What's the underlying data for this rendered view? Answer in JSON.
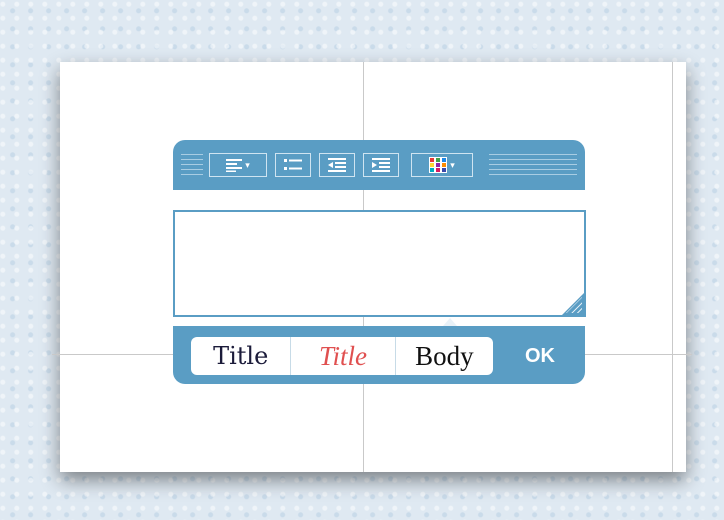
{
  "toolbar": {
    "buttons": [
      {
        "icon": "align-left-icon",
        "has_dropdown": true
      },
      {
        "icon": "bullet-list-icon",
        "has_dropdown": false
      },
      {
        "icon": "outdent-icon",
        "has_dropdown": false
      },
      {
        "icon": "indent-icon",
        "has_dropdown": false
      },
      {
        "icon": "color-grid-icon",
        "has_dropdown": true
      }
    ]
  },
  "editor": {
    "value": "",
    "placeholder": ""
  },
  "style_presets": {
    "title_dark": "Title",
    "title_red": "Title",
    "body": "Body"
  },
  "actions": {
    "ok_label": "OK"
  },
  "colors": {
    "accent": "#5a9dc4",
    "title_red": "#e05050",
    "title_dark": "#1b1b3a"
  }
}
